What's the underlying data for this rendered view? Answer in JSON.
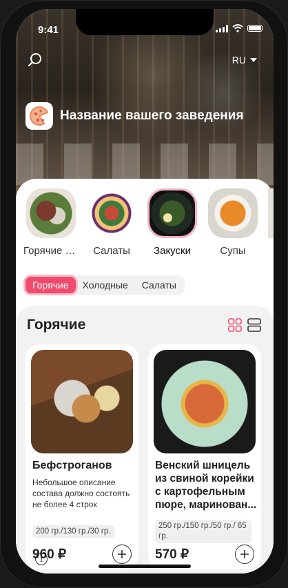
{
  "status_bar": {
    "time": "9:41"
  },
  "header": {
    "language": "RU",
    "restaurant_name": "Название вашего заведения"
  },
  "categories": [
    {
      "label": "Горячие блюда",
      "active": false
    },
    {
      "label": "Салаты",
      "active": false
    },
    {
      "label": "Закуски",
      "active": true
    },
    {
      "label": "Супы",
      "active": false
    },
    {
      "label": "",
      "active": false
    }
  ],
  "subcategories": [
    {
      "label": "Горячие",
      "active": true
    },
    {
      "label": "Холодные",
      "active": false
    },
    {
      "label": "Салаты",
      "active": false
    }
  ],
  "section": {
    "title": "Горячие"
  },
  "products": [
    {
      "name": "Бефстроганов",
      "description": "Небольшое описание состава должно состоять не более 4 строк",
      "weight": "200 гр./130 гр./30 гр.",
      "price": "960 ₽"
    },
    {
      "name": "Венский шницель из свиной корейки с картофельным пюре, маринован...",
      "description": "",
      "weight": "250 гр./150 гр./50 гр./ 65 гр.",
      "price": "570 ₽"
    }
  ],
  "colors": {
    "accent": "#ef4b6e",
    "accent_light": "#f6b9c7"
  }
}
